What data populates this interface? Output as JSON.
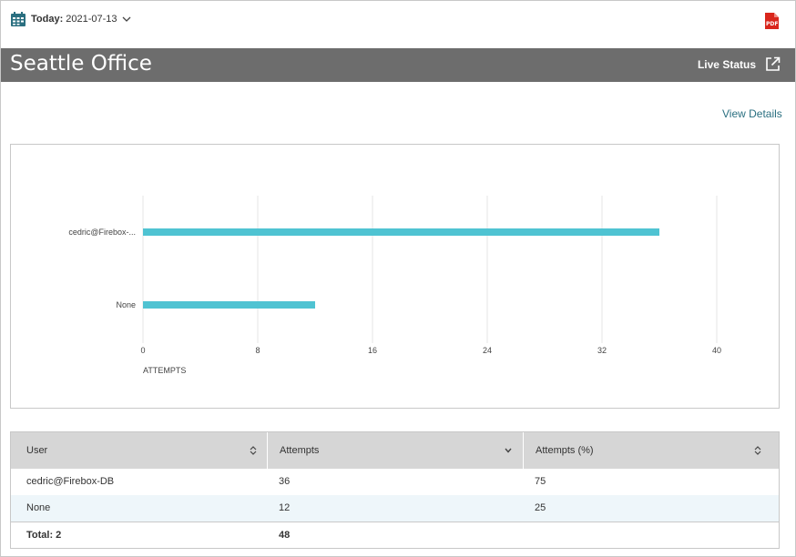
{
  "toolbar": {
    "date_label": "Today:",
    "date_value": "2021-07-13",
    "calendar_icon": "calendar-icon",
    "dropdown_icon": "chevron-down-icon",
    "pdf_icon": "pdf-icon"
  },
  "header": {
    "title": "Seattle Office",
    "live_status": "Live Status",
    "live_status_icon": "external-link-icon",
    "background": "#6d6d6d"
  },
  "view_details": "View Details",
  "chart_data": {
    "type": "bar",
    "orientation": "horizontal",
    "categories": [
      "cedric@Firebox-...",
      "None"
    ],
    "values": [
      36,
      12
    ],
    "xlabel": "ATTEMPTS",
    "xlim": [
      0,
      40
    ],
    "xticks": [
      0,
      8,
      16,
      24,
      32,
      40
    ],
    "grid": true,
    "bar_color": "#4fc3d2"
  },
  "table": {
    "columns": [
      {
        "label": "User",
        "sort_icon": "sort-icon"
      },
      {
        "label": "Attempts",
        "sort_icon": "chevron-down-icon"
      },
      {
        "label": "Attempts (%)",
        "sort_icon": "sort-icon"
      }
    ],
    "rows": [
      {
        "user": "cedric@Firebox-DB",
        "attempts": "36",
        "percent": "75"
      },
      {
        "user": "None",
        "attempts": "12",
        "percent": "25"
      }
    ],
    "total": {
      "label": "Total: 2",
      "attempts": "48"
    }
  }
}
